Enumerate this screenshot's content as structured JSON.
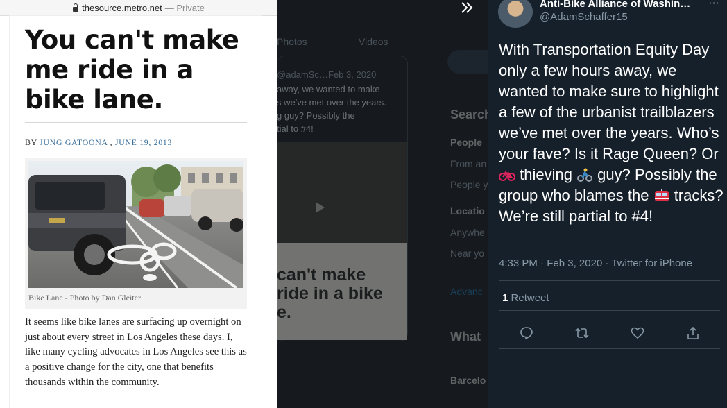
{
  "browser": {
    "domain": "thesource.metro.net",
    "privacy": "— Private"
  },
  "article": {
    "title": "You can't make me ride in a bike lane.",
    "byline_prefix": "BY",
    "author": "JUNG GATOONA",
    "byline_sep": ",",
    "date": "JUNE 19, 2013",
    "caption": "Bike Lane - Photo by Dan Gleiter",
    "body": "It seems like bike lanes are surfacing up overnight on just about every street in Los Angeles these days. I, like many cycling advocates in Los Angeles see this as a positive change for the city, one that benefits thousands within the community."
  },
  "background_panel": {
    "tab_photos": "Photos",
    "tab_videos": "Videos",
    "quoted_user": "@adamSc…",
    "quoted_date": "Feb 3, 2020",
    "quoted_line1": "away, we wanted to make",
    "quoted_line2": "s we've met over the years.",
    "quoted_line3": "g guy? Possibly the",
    "quoted_line4": "tial to #4!",
    "quoted_title_line1": "can't make",
    "quoted_title_line2": "ride in a bike",
    "quoted_title_line3": "e.",
    "search_heading": "Search",
    "people": "People",
    "from_any": "From an",
    "people_follow": "People y",
    "location": "Locatio",
    "anywhere": "Anywhe",
    "near_you": "Near yo",
    "advanced": "Advanc",
    "whats_happening": "What",
    "trend_location": "Barcelo"
  },
  "tweet": {
    "display_name": "Anti-Bike Alliance of Washin…",
    "handle": "@AdamSchaffer15",
    "text_1": "With Transportation Equity Day only a few hours away, we wanted to make sure to highlight a few of the urbanist trailblazers we’ve met over the years. Who’s your fave? Is it Rage Queen? Or ",
    "text_2": " thieving ",
    "text_3": " guy? Possibly the group who blames the ",
    "text_4": " tracks? We’re still partial to #4!",
    "time": "4:33 PM",
    "date": "Feb 3, 2020",
    "source": "Twitter for iPhone",
    "meta_sep": "·",
    "retweet_count": "1",
    "retweet_label": "Retweet",
    "icons": [
      "reply-icon",
      "retweet-icon",
      "like-icon",
      "share-icon"
    ]
  },
  "colors": {
    "tweet_bg": "#15202b",
    "muted": "#8899a6",
    "link": "#3a6f9a"
  }
}
